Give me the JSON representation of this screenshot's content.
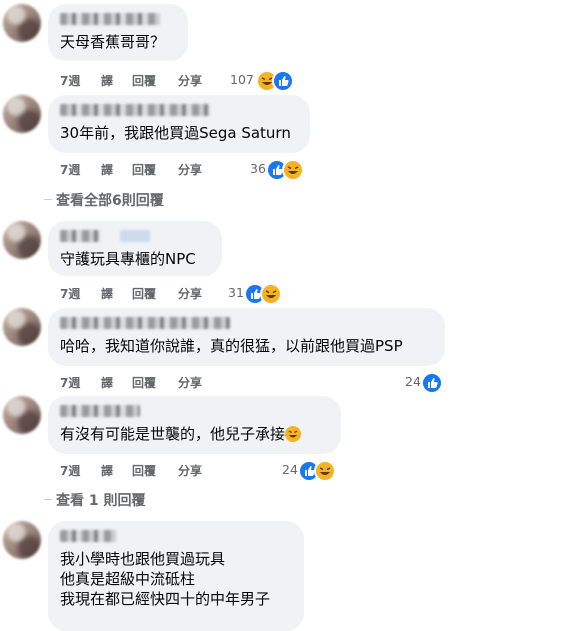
{
  "comments": [
    {
      "text": "天母香蕉哥哥？",
      "time": "7週",
      "translate": "譯",
      "reply": "回覆",
      "share": "分享",
      "count": "107"
    },
    {
      "text": "30年前，我跟他買過Sega Saturn",
      "time": "7週",
      "translate": "譯",
      "reply": "回覆",
      "share": "分享",
      "count": "36"
    },
    {
      "text": "守護玩具專櫃的NPC",
      "time": "7週",
      "translate": "譯",
      "reply": "回覆",
      "share": "分享",
      "count": "31"
    },
    {
      "text": "哈哈，我知道你說誰，真的很猛，以前跟他買過PSP",
      "time": "7週",
      "translate": "譯",
      "reply": "回覆",
      "share": "分享",
      "count": "24"
    },
    {
      "text": "有沒有可能是世襲的，他兒子承接",
      "time": "7週",
      "translate": "譯",
      "reply": "回覆",
      "share": "分享",
      "count": "24"
    },
    {
      "lines": [
        "我小學時也跟他買過玩具",
        "他真是超級中流砥柱",
        "我現在都已經快四十的中年男子"
      ]
    }
  ],
  "view_replies": [
    "查看全部6則回覆",
    "查看 1 則回覆"
  ],
  "colors": {
    "like": "#1877f2",
    "haha": "#f7b125",
    "bubble": "#f0f2f5",
    "meta": "#65676b"
  }
}
